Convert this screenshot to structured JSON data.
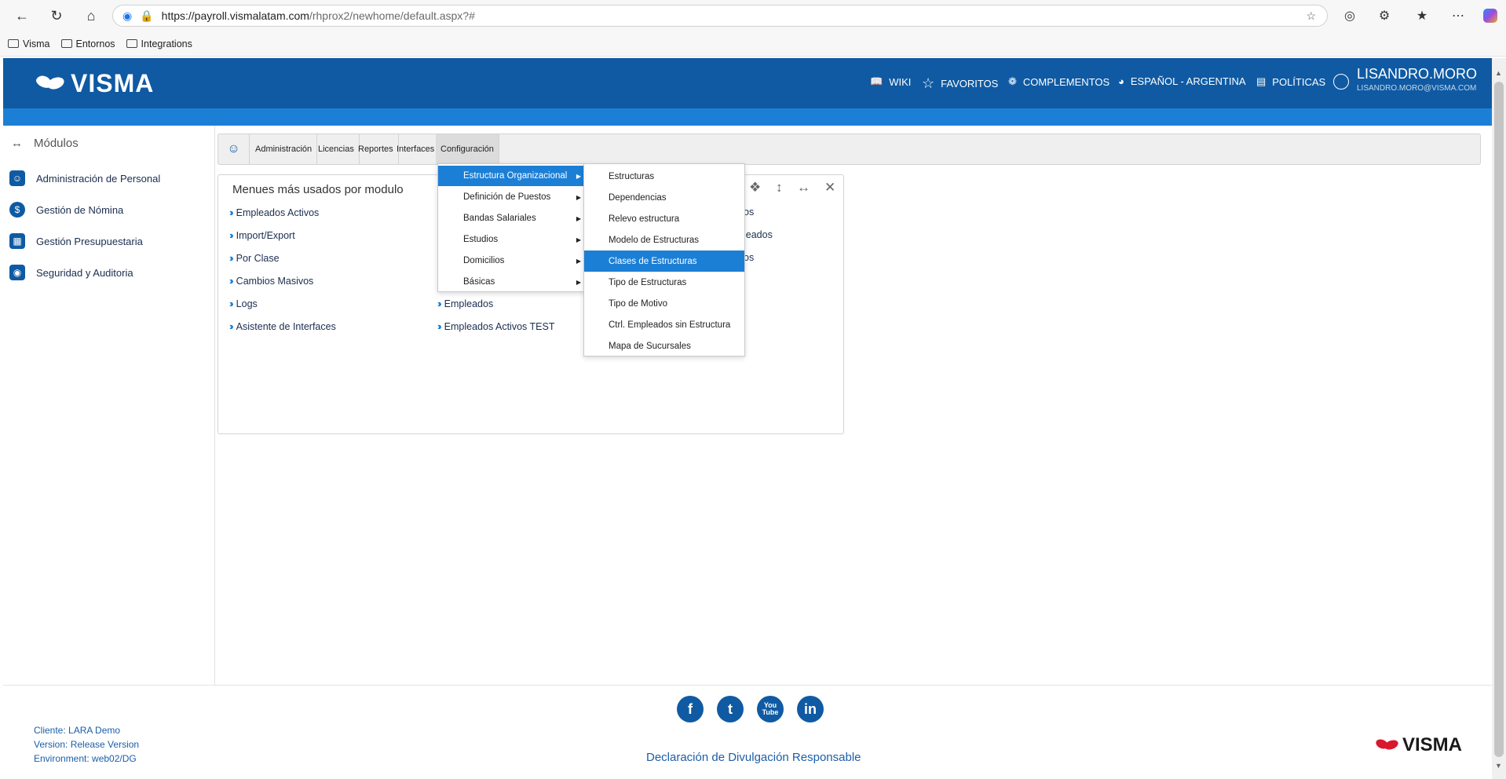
{
  "browser": {
    "url_host": "https://payroll.vismalatam.com",
    "url_path": "/rhprox2/newhome/default.aspx?#",
    "bookmarks": [
      "Visma",
      "Entornos",
      "Integrations"
    ]
  },
  "header": {
    "logo_text": "VISMA",
    "nav": [
      {
        "label": "WIKI",
        "icon": "book-icon"
      },
      {
        "label": "FAVORITOS",
        "icon": "star-icon"
      },
      {
        "label": "COMPLEMENTOS",
        "icon": "puzzle-icon"
      },
      {
        "label": "ESPAÑOL - ARGENTINA",
        "icon": "globe-icon"
      },
      {
        "label": "POLÍTICAS",
        "icon": "document-icon"
      }
    ],
    "user_name": "LISANDRO.MORO",
    "user_email": "LISANDRO.MORO@VISMA.COM"
  },
  "sidebar": {
    "title": "Módulos",
    "items": [
      {
        "label": "Administración de Personal",
        "icon": "people-icon"
      },
      {
        "label": "Gestión de Nómina",
        "icon": "dollar-icon"
      },
      {
        "label": "Gestión Presupuestaria",
        "icon": "calculator-icon"
      },
      {
        "label": "Seguridad y Auditoria",
        "icon": "lock-icon"
      }
    ]
  },
  "tabs": [
    "Administración",
    "Licencias",
    "Reportes",
    "Interfaces",
    "Configuración"
  ],
  "widget": {
    "title": "Menues más usados por modulo",
    "col1": [
      "Empleados Activos",
      "Import/Export",
      "Por Clase",
      "Cambios Masivos",
      "Logs",
      "Asistente de Interfaces"
    ],
    "col2": [
      "Empleados",
      "Empleados Activos TEST"
    ],
    "col3_partial": [
      "os",
      "leados",
      "os"
    ]
  },
  "menu_level1": [
    "Estructura Organizacional",
    "Definición de Puestos",
    "Bandas Salariales",
    "Estudios",
    "Domicilios",
    "Básicas"
  ],
  "menu_level2": [
    "Estructuras",
    "Dependencias",
    "Relevo estructura",
    "Modelo de Estructuras",
    "Clases de Estructuras",
    "Tipo de Estructuras",
    "Tipo de Motivo",
    "Ctrl. Empleados sin Estructura",
    "Mapa de Sucursales"
  ],
  "footer": {
    "client": "Cliente: LARA Demo",
    "version": "Version: Release Version",
    "environment": "Environment: web02/DG",
    "disclosure": "Declaración de Divulgación Responsable",
    "logo_text": "VISMA",
    "social": [
      {
        "glyph": "f",
        "icon": "facebook-icon"
      },
      {
        "glyph": "t",
        "icon": "twitter-icon"
      },
      {
        "glyph": "You Tube",
        "icon": "youtube-icon"
      },
      {
        "glyph": "in",
        "icon": "linkedin-icon"
      }
    ]
  },
  "colors": {
    "header_blue": "#0f5aa3",
    "accent_blue": "#1c7fd6",
    "visma_red": "#d9182d"
  }
}
